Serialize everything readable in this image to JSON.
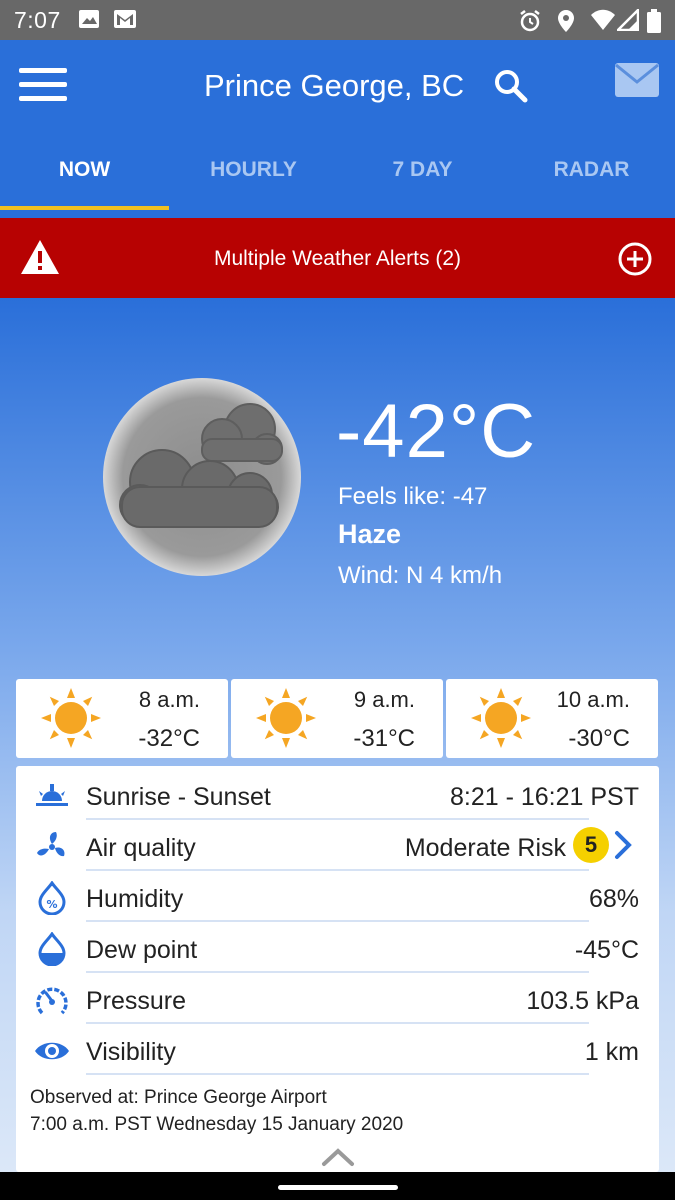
{
  "status_bar": {
    "time": "7:07",
    "left_icons": [
      "image-icon",
      "gmail-icon"
    ],
    "right_icons": [
      "alarm-icon",
      "location-icon",
      "wifi-icon",
      "signal-icon",
      "battery-icon"
    ]
  },
  "app_bar": {
    "city": "Prince George, BC",
    "menu_icon": "hamburger-menu-icon",
    "search_icon": "search-icon",
    "mail_icon": "mail-icon"
  },
  "tabs": [
    {
      "label": "NOW",
      "active": true
    },
    {
      "label": "HOURLY",
      "active": false
    },
    {
      "label": "7 DAY",
      "active": false
    },
    {
      "label": "RADAR",
      "active": false
    }
  ],
  "alert": {
    "text": "Multiple Weather Alerts (2)",
    "icon": "warning-icon",
    "expand_icon": "plus-circle-icon",
    "color": "#b70202"
  },
  "current": {
    "temperature": "-42°C",
    "feels_like": "Feels like: -47",
    "condition": "Haze",
    "wind": "Wind: N 4 km/h",
    "icon": "haze-cloud-moon-icon"
  },
  "hourly": [
    {
      "time": "8 a.m.",
      "temp": "-32°C",
      "icon": "sun-icon"
    },
    {
      "time": "9 a.m.",
      "temp": "-31°C",
      "icon": "sun-icon"
    },
    {
      "time": "10 a.m.",
      "temp": "-30°C",
      "icon": "sun-icon"
    }
  ],
  "details": [
    {
      "label": "Sunrise - Sunset",
      "value": "8:21 - 16:21 PST",
      "icon": "sunrise-icon"
    },
    {
      "label": "Air quality",
      "value": "Moderate Risk",
      "badge": "5",
      "icon": "fan-icon"
    },
    {
      "label": "Humidity",
      "value": "68%",
      "icon": "humidity-icon"
    },
    {
      "label": "Dew point",
      "value": "-45°C",
      "icon": "dew-drop-icon"
    },
    {
      "label": "Pressure",
      "value": "103.5 kPa",
      "icon": "gauge-icon"
    },
    {
      "label": "Visibility",
      "value": "1 km",
      "icon": "eye-icon"
    }
  ],
  "observed": {
    "line1": "Observed at: Prince George Airport",
    "line2": "7:00 a.m. PST Wednesday 15 January 2020"
  },
  "colors": {
    "primary": "#2a6fd9",
    "tab_indicator": "#f0c020",
    "icon_blue": "#2a6fd9",
    "sun": "#f5a623",
    "aq_badge": "#f5d000"
  }
}
